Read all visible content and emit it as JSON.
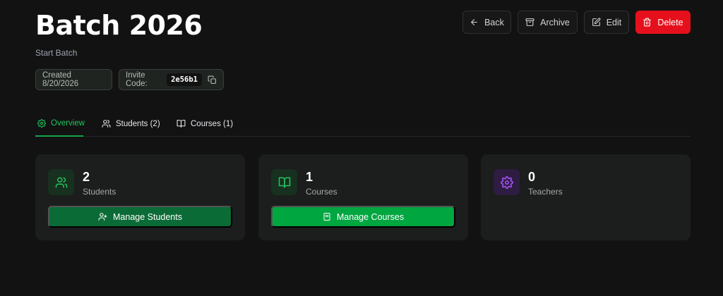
{
  "header": {
    "title": "Batch 2026",
    "subtitle": "Start Batch",
    "created": "Created 8/20/2026",
    "invite_label": "Invite Code:",
    "invite_code": "2e56b1"
  },
  "actions": {
    "back": "Back",
    "archive": "Archive",
    "edit": "Edit",
    "delete": "Delete"
  },
  "tabs": [
    {
      "label": "Overview",
      "active": true
    },
    {
      "label": "Students (2)",
      "active": false
    },
    {
      "label": "Courses (1)",
      "active": false
    }
  ],
  "stats": [
    {
      "value": "2",
      "label": "Students",
      "icon": "users-icon",
      "button": "Manage Students"
    },
    {
      "value": "1",
      "label": "Courses",
      "icon": "book-open-icon",
      "button": "Manage Courses"
    },
    {
      "value": "0",
      "label": "Teachers",
      "icon": "gear-icon"
    }
  ],
  "colors": {
    "background": "#121212",
    "accent_green": "#22c55e",
    "delete_red": "#e5101b",
    "manage_students_btn": "#0b6b36",
    "manage_courses_btn": "#00a640",
    "teachers_icon": "#a855f7"
  }
}
